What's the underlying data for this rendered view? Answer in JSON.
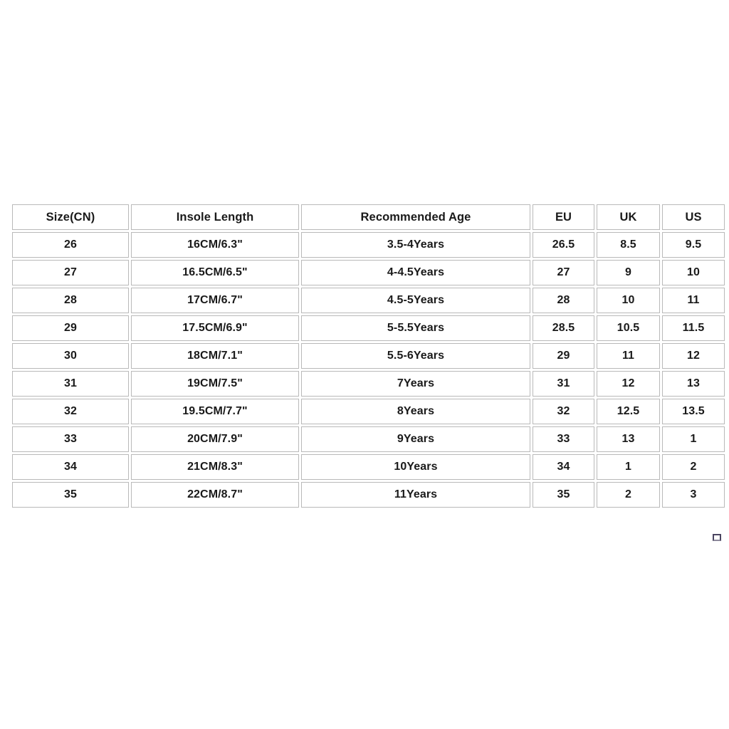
{
  "table": {
    "columns": [
      "Size(CN)",
      "Insole Length",
      "Recommended Age",
      "EU",
      "UK",
      "US"
    ],
    "rows": [
      [
        "26",
        "16CM/6.3\"",
        "3.5-4Years",
        "26.5",
        "8.5",
        "9.5"
      ],
      [
        "27",
        "16.5CM/6.5\"",
        "4-4.5Years",
        "27",
        "9",
        "10"
      ],
      [
        "28",
        "17CM/6.7\"",
        "4.5-5Years",
        "28",
        "10",
        "11"
      ],
      [
        "29",
        "17.5CM/6.9\"",
        "5-5.5Years",
        "28.5",
        "10.5",
        "11.5"
      ],
      [
        "30",
        "18CM/7.1\"",
        "5.5-6Years",
        "29",
        "11",
        "12"
      ],
      [
        "31",
        "19CM/7.5\"",
        "7Years",
        "31",
        "12",
        "13"
      ],
      [
        "32",
        "19.5CM/7.7\"",
        "8Years",
        "32",
        "12.5",
        "13.5"
      ],
      [
        "33",
        "20CM/7.9\"",
        "9Years",
        "33",
        "13",
        "1"
      ],
      [
        "34",
        "21CM/8.3\"",
        "10Years",
        "34",
        "1",
        "2"
      ],
      [
        "35",
        "22CM/8.7\"",
        "11Years",
        "35",
        "2",
        "3"
      ]
    ]
  },
  "colors": {
    "background": "#ffffff",
    "cell_border": "#b9b9b9",
    "text": "#1a1a1a",
    "artifact": "#4a4560"
  }
}
